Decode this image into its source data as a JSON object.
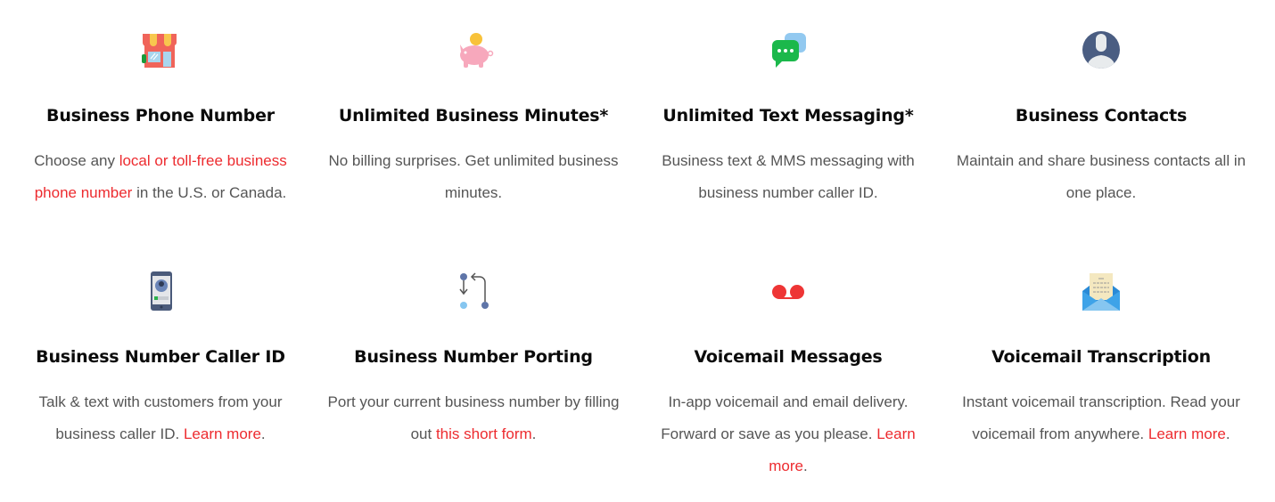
{
  "colors": {
    "link": "#ed2b2f",
    "heading": "#0b0b0b",
    "body": "#555555"
  },
  "features": [
    {
      "icon": "storefront-icon",
      "title": "Business Phone Number",
      "desc_before": "Choose any ",
      "link": "local or toll-free business phone number",
      "desc_after": " in the U.S. or Canada."
    },
    {
      "icon": "piggy-bank-icon",
      "title": "Unlimited Business Minutes*",
      "desc_before": "No billing surprises. Get unlimited business minutes.",
      "link": "",
      "desc_after": ""
    },
    {
      "icon": "chat-bubbles-icon",
      "title": "Unlimited Text Messaging*",
      "desc_before": "Business text & MMS messaging with business number caller ID.",
      "link": "",
      "desc_after": ""
    },
    {
      "icon": "contact-avatar-icon",
      "title": "Business Contacts",
      "desc_before": "Maintain and share business contacts all in one place.",
      "link": "",
      "desc_after": ""
    },
    {
      "icon": "phone-caller-id-icon",
      "title": "Business Number Caller ID",
      "desc_before": "Talk & text with customers from your business caller ID. ",
      "link": "Learn more",
      "desc_after": "."
    },
    {
      "icon": "porting-arrows-icon",
      "title": "Business Number Porting",
      "desc_before": "Port your current business number by filling out ",
      "link": "this short form",
      "desc_after": "."
    },
    {
      "icon": "voicemail-icon",
      "title": "Voicemail Messages",
      "desc_before": "In-app voicemail and email delivery. Forward or save as you please. ",
      "link": "Learn more",
      "desc_after": "."
    },
    {
      "icon": "envelope-letter-icon",
      "title": "Voicemail Transcription",
      "desc_before": "Instant voicemail transcription. Read your voicemail from anywhere. ",
      "link": "Learn more",
      "desc_after": "."
    }
  ]
}
